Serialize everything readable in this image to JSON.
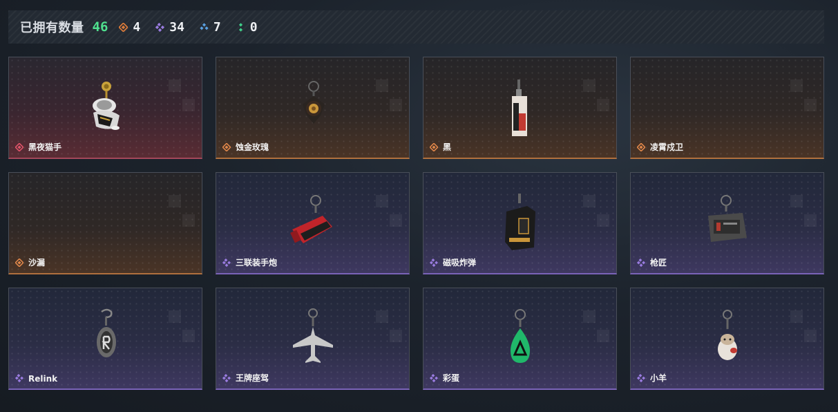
{
  "header": {
    "title": "已拥有数量",
    "count": "46",
    "stats": [
      {
        "icon": "orange-diamond-icon",
        "color": "#d97a3a",
        "value": "4"
      },
      {
        "icon": "purple-diamond-icon",
        "color": "#9a7ce0",
        "value": "34"
      },
      {
        "icon": "blue-diamond-icon",
        "color": "#5aa0e0",
        "value": "7"
      },
      {
        "icon": "green-diamond-icon",
        "color": "#3fd08a",
        "value": "0"
      }
    ]
  },
  "cards": [
    {
      "name": "黑夜猫手",
      "rarity": "red",
      "rank_color": "#e0546a",
      "art": "cat-figure"
    },
    {
      "name": "蚀金玫瑰",
      "rarity": "orange",
      "rank_color": "#e0874a",
      "art": "rose-charm"
    },
    {
      "name": "黑",
      "rarity": "orange",
      "rank_color": "#e0874a",
      "art": "card-charm"
    },
    {
      "name": "凌霄戍卫",
      "rarity": "orange",
      "rank_color": "#e0874a",
      "art": "none"
    },
    {
      "name": "沙漏",
      "rarity": "orange",
      "rank_color": "#e0874a",
      "art": "none"
    },
    {
      "name": "三联装手炮",
      "rarity": "purple",
      "rank_color": "#9a7ce0",
      "art": "cannon-charm"
    },
    {
      "name": "磁吸炸弹",
      "rarity": "purple",
      "rank_color": "#9a7ce0",
      "art": "bomb-charm"
    },
    {
      "name": "枪匠",
      "rarity": "purple",
      "rank_color": "#9a7ce0",
      "art": "box-charm"
    },
    {
      "name": "Relink",
      "rarity": "purple",
      "rank_color": "#9a7ce0",
      "art": "relink-charm"
    },
    {
      "name": "王牌座驾",
      "rarity": "purple",
      "rank_color": "#9a7ce0",
      "art": "jet-charm"
    },
    {
      "name": "彩蛋",
      "rarity": "purple",
      "rank_color": "#9a7ce0",
      "art": "egg-charm"
    },
    {
      "name": "小羊",
      "rarity": "purple",
      "rank_color": "#9a7ce0",
      "art": "sheep-charm"
    }
  ]
}
